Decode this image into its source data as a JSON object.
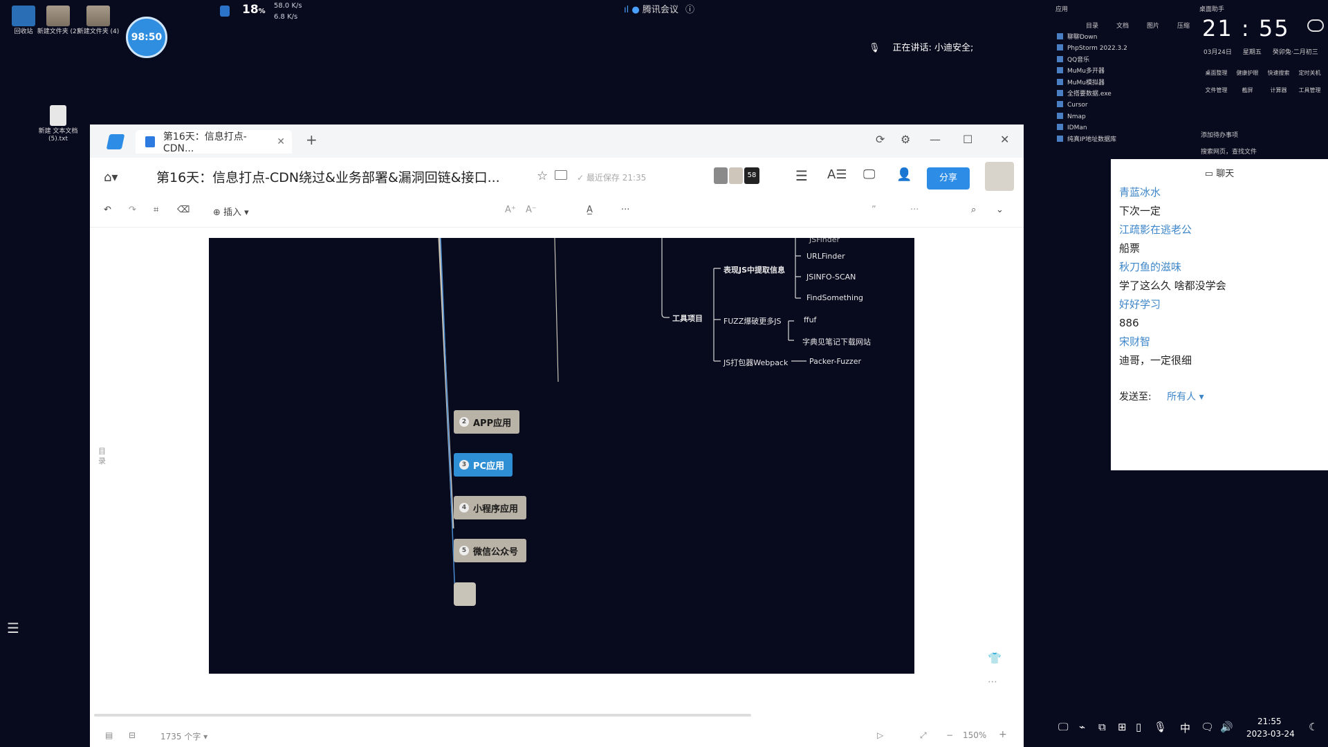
{
  "desktop": {
    "icons": [
      {
        "label": "回收站"
      },
      {
        "label": "新建文件夹 (2)"
      },
      {
        "label": "新建文件夹 (4)"
      },
      {
        "label": "新建 文本文档 (5).txt"
      }
    ],
    "timer": "98:50",
    "cpu_percent": "18",
    "cpu_unit": "%",
    "net_up": "58.0 K/s",
    "net_down": "6.8 K/s",
    "meeting_app": "腾讯会议",
    "speaking_label": "正在讲话: 小迪安全;"
  },
  "browser": {
    "tab_title": "第16天：信息打点-CDN...",
    "tab_add": "+",
    "doc_title": "第16天：信息打点-CDN绕过&业务部署&漏洞回链&接口...",
    "saved_status": "最近保存 21:35",
    "collab_count": "58",
    "share_label": "分享",
    "toolbar": {
      "insert_label": "插入"
    },
    "outline_label": "目录",
    "mindmap": {
      "upper_items": [
        "URLFinder",
        "JSINFO-SCAN",
        "FindSomething"
      ],
      "upper_group": "表现JS中提取信息",
      "tools_label": "工具项目",
      "fuzz_group": "FUZZ爆破更多JS",
      "fuzz_items": [
        "ffuf",
        "字典见笔记下载网站"
      ],
      "webpack_group": "JS打包器Webpack",
      "webpack_item": "Packer-Fuzzer",
      "cut_label": "JSFinder",
      "nodes": [
        {
          "num": "2",
          "label": "APP应用"
        },
        {
          "num": "3",
          "label": "PC应用"
        },
        {
          "num": "4",
          "label": "小程序应用"
        },
        {
          "num": "5",
          "label": "微信公众号"
        }
      ]
    },
    "statusbar": {
      "word_count": "1735 个字",
      "zoom": "150%"
    }
  },
  "clock": {
    "time": "21 : 55",
    "date": "03月24日",
    "weekday": "星期五",
    "lunar": "癸卯兔·二月初三"
  },
  "app_list": [
    "聊聊Down",
    "PhpStorm 2022.3.2",
    "QQ音乐",
    "MuMu多开器",
    "MuMu模拟器",
    "全搭要数据.exe",
    "Cursor",
    "Nmap",
    "IDMan",
    "纯真IP地址数据库"
  ],
  "quick_tools": [
    "桌面整理",
    "健康护眼",
    "快速搜索",
    "定时关机",
    "文件管理",
    "截屏",
    "计算器",
    "工具管理"
  ],
  "widget_labels": {
    "top_left": "应用",
    "top_right": "桌面助手",
    "tabs": [
      "目录",
      "文档",
      "图片",
      "压缩"
    ],
    "todo": "添加待办事项",
    "search": "搜索网页，查找文件"
  },
  "chat": {
    "title": "聊天",
    "messages": [
      {
        "user": "青蓝冰水",
        "text": "下次一定"
      },
      {
        "user": "江疏影在逃老公",
        "text": "船票"
      },
      {
        "user": "秋刀鱼的滋味",
        "text": "学了这么久 啥都没学会"
      },
      {
        "user": "好好学习",
        "text": "886"
      },
      {
        "user": "宋财智",
        "text": "迪哥，一定很细"
      }
    ],
    "send_to_label": "发送至:",
    "send_to_value": "所有人"
  },
  "taskbar": {
    "ime": "中",
    "time": "21:55",
    "date": "2023-03-24"
  }
}
